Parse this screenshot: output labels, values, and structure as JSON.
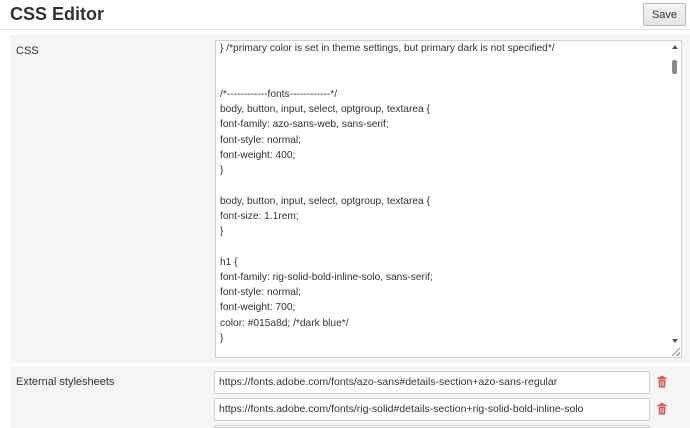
{
  "header": {
    "title": "CSS Editor",
    "save_label": "Save"
  },
  "css_field": {
    "label": "CSS",
    "lines": [
      "} /*primary color is set in theme settings, but primary dark is not specified*/",
      "",
      "",
      "/*------------fonts------------*/",
      "body, button, input, select, optgroup, textarea {",
      "font-family: azo-sans-web, sans-serif;",
      "font-style: normal;",
      "font-weight: 400;",
      "}",
      "",
      "body, button, input, select, optgroup, textarea {",
      "font-size: 1.1rem;",
      "}",
      "",
      "h1 {",
      "font-family: rig-solid-bold-inline-solo, sans-serif;",
      "font-style: normal;",
      "font-weight: 700;",
      "color: #015a8d; /*dark blue*/",
      "}"
    ]
  },
  "external_stylesheets": {
    "label": "External stylesheets",
    "urls": [
      "https://fonts.adobe.com/fonts/azo-sans#details-section+azo-sans-regular",
      "https://fonts.adobe.com/fonts/rig-solid#details-section+rig-solid-bold-inline-solo"
    ],
    "delete_icon": "trash-icon"
  },
  "colors": {
    "delete_icon": "#d9534f",
    "panel_background": "#f5f5f5"
  }
}
